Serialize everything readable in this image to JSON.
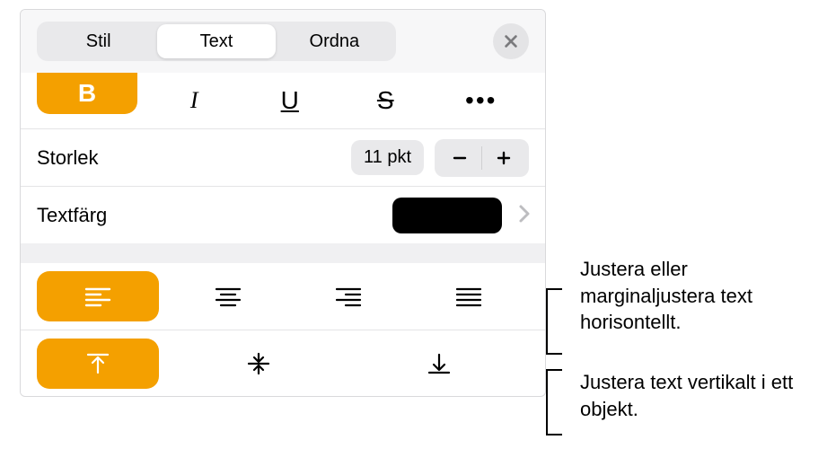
{
  "header": {
    "tabs": [
      "Stil",
      "Text",
      "Ordna"
    ],
    "active_index": 1
  },
  "styleRow": {
    "bold": "B",
    "italic": "I",
    "underline": "U",
    "strike": "S",
    "more": "•••"
  },
  "size": {
    "label": "Storlek",
    "value": "11 pkt"
  },
  "color": {
    "label": "Textfärg",
    "value": "#000000"
  },
  "callouts": {
    "horizontal": "Justera eller marginaljustera text horisontellt.",
    "vertical": "Justera text vertikalt i ett objekt."
  }
}
